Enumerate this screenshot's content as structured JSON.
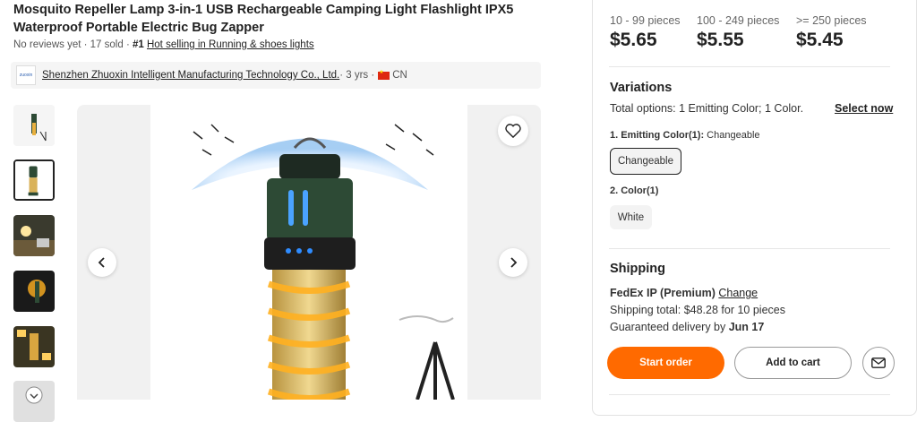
{
  "product": {
    "title": "Mosquito Repeller Lamp 3-in-1 USB Rechargeable Camping Light Flashlight IPX5 Waterproof Portable Electric Bug Zapper",
    "reviews": "No reviews yet",
    "separator": " · ",
    "sold": "17 sold",
    "rank": "#1",
    "rank_link": "Hot selling in Running & shoes lights"
  },
  "supplier": {
    "logo_text": "zuoxin",
    "name": "Shenzhen Zhuoxin Intelligent Manufacturing Technology Co., Ltd.",
    "years": " · 3 yrs · ",
    "country": "CN"
  },
  "gallery": {
    "thumbnails": [
      "thumb-1",
      "thumb-2",
      "thumb-3",
      "thumb-4",
      "thumb-5",
      "thumb-6"
    ],
    "active_index": 1
  },
  "pricing": {
    "tiers": [
      {
        "qty": "10 - 99 pieces",
        "price": "$5.65"
      },
      {
        "qty": "100 - 249 pieces",
        "price": "$5.55"
      },
      {
        "qty": ">= 250 pieces",
        "price": "$5.45"
      }
    ]
  },
  "variations": {
    "title": "Variations",
    "total_options": "Total options: 1 Emitting Color; 1 Color.",
    "select_now": "Select now",
    "emitting_label": "1. Emitting Color(1):",
    "emitting_value": "Changeable",
    "emitting_option": "Changeable",
    "color_label": "2. Color(1)",
    "color_option": "White"
  },
  "shipping": {
    "title": "Shipping",
    "method": "FedEx IP (Premium)",
    "change": "Change",
    "total": "Shipping total: $48.28 for 10 pieces",
    "delivery_prefix": "Guaranteed delivery by ",
    "delivery_date": "Jun 17"
  },
  "actions": {
    "start_order": "Start order",
    "add_to_cart": "Add to cart",
    "message_icon": "mail-icon"
  },
  "colors": {
    "accent": "#ff6a00",
    "lamp_green": "#2d4a35",
    "glow_orange": "#ffb020",
    "flag_red": "#de2910"
  }
}
